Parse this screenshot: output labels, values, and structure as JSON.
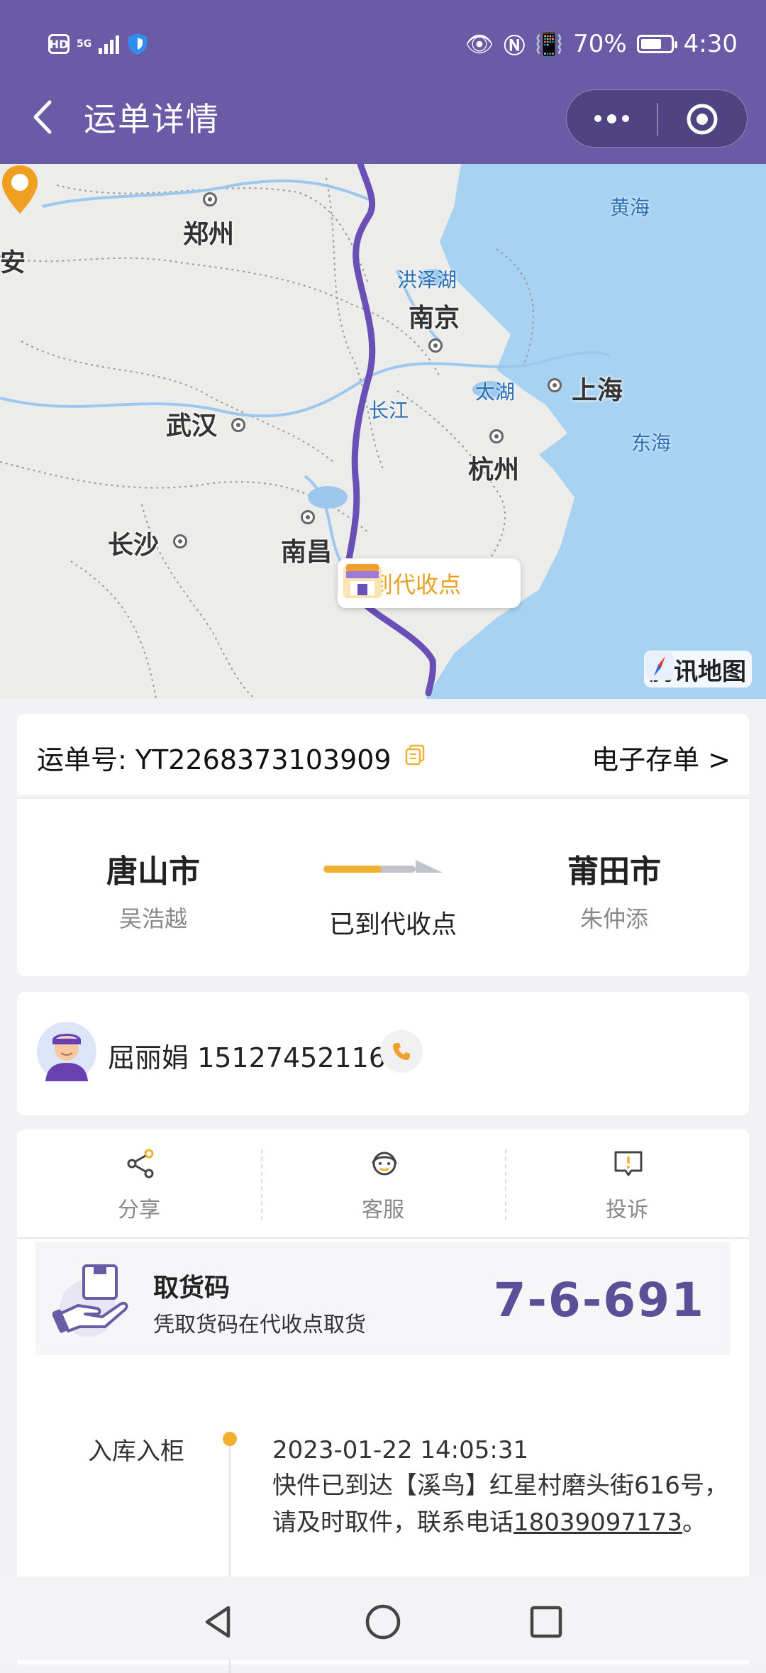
{
  "status_bar": {
    "hd": "HD",
    "network": "5G",
    "battery": "70%",
    "battery_level": 0.7,
    "time": "4:30"
  },
  "header": {
    "title": "运单详情"
  },
  "map": {
    "cities": [
      {
        "name": "郑州"
      },
      {
        "name": "安"
      },
      {
        "name": "南京"
      },
      {
        "name": "上海"
      },
      {
        "name": "武汉"
      },
      {
        "name": "杭州"
      },
      {
        "name": "长沙"
      },
      {
        "name": "南昌"
      }
    ],
    "water": [
      "黄海",
      "洪泽湖",
      "长江",
      "太湖",
      "东海"
    ],
    "bubble_label": "已到代收点",
    "provider": "腾讯地图",
    "route_color": "#6a4fb6"
  },
  "waybill": {
    "label": "运单号: YT2268373103909",
    "estub": "电子存单 >"
  },
  "route": {
    "from_city": "唐山市",
    "from_name": "吴浩越",
    "to_city": "莆田市",
    "to_name": "朱仲添",
    "status": "已到代收点"
  },
  "courier": {
    "text": "屈丽娟 15127452116"
  },
  "actions": [
    {
      "label": "分享"
    },
    {
      "label": "客服"
    },
    {
      "label": "投诉"
    }
  ],
  "pickup": {
    "title": "取货码",
    "subtitle": "凭取货码在代收点取货",
    "code": "7-6-691"
  },
  "timeline": [
    {
      "label": "入库入柜",
      "time": "2023-01-22 14:05:31",
      "text": "快件已到达【溪鸟】红星村磨头街616号，请及时取件，联系电话",
      "phone": "18039097173",
      "end": "。"
    }
  ],
  "colors": {
    "brand": "#6a5ba6",
    "accent": "#f0b030",
    "code": "#5b4f98"
  }
}
